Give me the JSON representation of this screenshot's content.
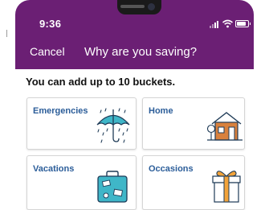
{
  "status_bar": {
    "time": "9:36",
    "icons": [
      "signal-icon",
      "wifi-icon",
      "battery-icon"
    ]
  },
  "header": {
    "cancel_label": "Cancel",
    "title": "Why are you saving?"
  },
  "subtitle": "You can add up to 10 buckets.",
  "buckets": [
    {
      "label": "Emergencies",
      "icon": "umbrella-rain-icon"
    },
    {
      "label": "Home",
      "icon": "house-icon"
    },
    {
      "label": "Vacations",
      "icon": "suitcase-icon"
    },
    {
      "label": "Occasions",
      "icon": "gift-icon"
    }
  ],
  "colors": {
    "header_bg": "#6b1f74",
    "label_blue": "#2b5d99",
    "teal_accent": "#3fb6c8",
    "orange_accent": "#f2a33a"
  }
}
